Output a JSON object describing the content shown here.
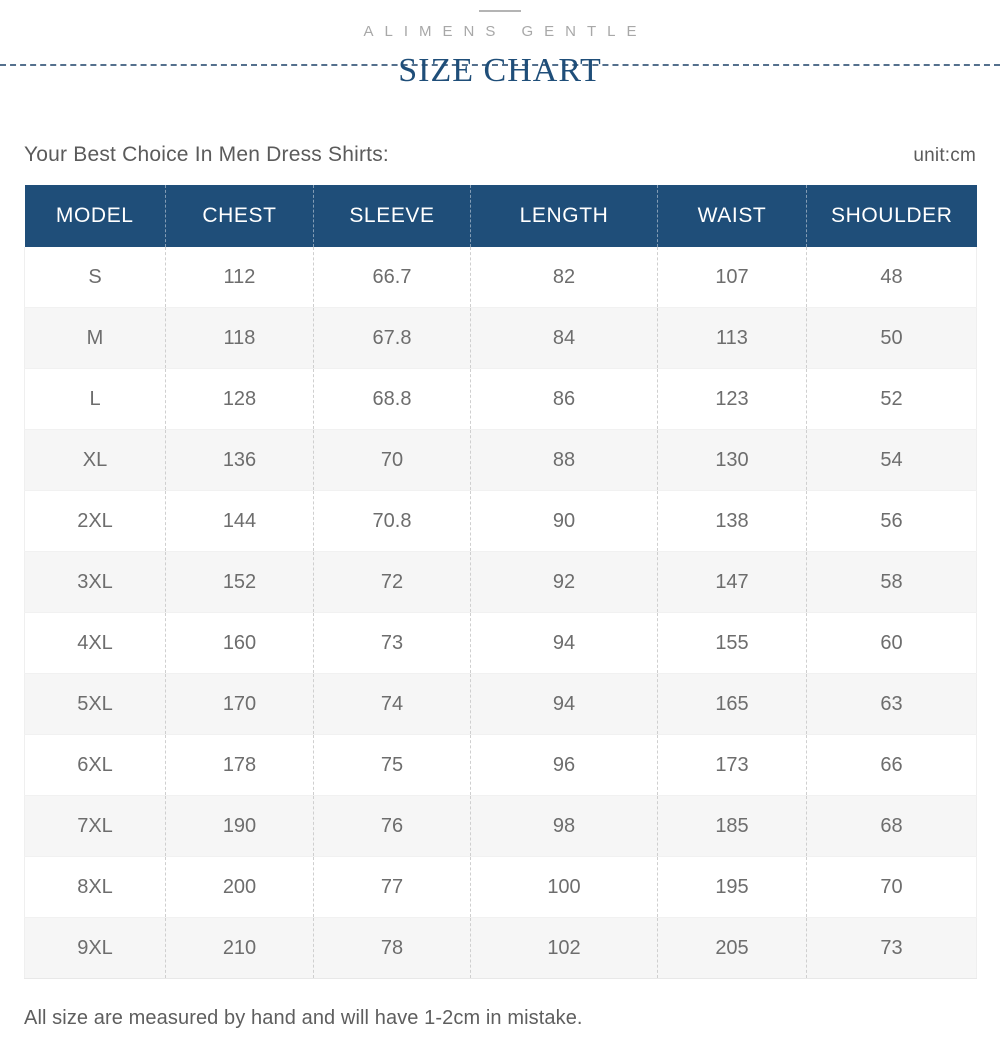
{
  "header": {
    "brand": "ALIMENS GENTLE",
    "title": "SIZE CHART",
    "accent_color": "#1f4e79",
    "brand_color": "#a8a8a8"
  },
  "subheader": {
    "intro": "Your Best Choice In Men Dress Shirts:",
    "unit": "unit:cm"
  },
  "table": {
    "columns": [
      "MODEL",
      "CHEST",
      "SLEEVE",
      "LENGTH",
      "WAIST",
      "SHOULDER"
    ],
    "header_bg": "#1f4e79",
    "rows": [
      {
        "model": "S",
        "chest": "112",
        "sleeve": "66.7",
        "length": "82",
        "waist": "107",
        "shoulder": "48"
      },
      {
        "model": "M",
        "chest": "118",
        "sleeve": "67.8",
        "length": "84",
        "waist": "113",
        "shoulder": "50"
      },
      {
        "model": "L",
        "chest": "128",
        "sleeve": "68.8",
        "length": "86",
        "waist": "123",
        "shoulder": "52"
      },
      {
        "model": "XL",
        "chest": "136",
        "sleeve": "70",
        "length": "88",
        "waist": "130",
        "shoulder": "54"
      },
      {
        "model": "2XL",
        "chest": "144",
        "sleeve": "70.8",
        "length": "90",
        "waist": "138",
        "shoulder": "56"
      },
      {
        "model": "3XL",
        "chest": "152",
        "sleeve": "72",
        "length": "92",
        "waist": "147",
        "shoulder": "58"
      },
      {
        "model": "4XL",
        "chest": "160",
        "sleeve": "73",
        "length": "94",
        "waist": "155",
        "shoulder": "60"
      },
      {
        "model": "5XL",
        "chest": "170",
        "sleeve": "74",
        "length": "94",
        "waist": "165",
        "shoulder": "63"
      },
      {
        "model": "6XL",
        "chest": "178",
        "sleeve": "75",
        "length": "96",
        "waist": "173",
        "shoulder": "66"
      },
      {
        "model": "7XL",
        "chest": "190",
        "sleeve": "76",
        "length": "98",
        "waist": "185",
        "shoulder": "68"
      },
      {
        "model": "8XL",
        "chest": "200",
        "sleeve": "77",
        "length": "100",
        "waist": "195",
        "shoulder": "70"
      },
      {
        "model": "9XL",
        "chest": "210",
        "sleeve": "78",
        "length": "102",
        "waist": "205",
        "shoulder": "73"
      }
    ]
  },
  "footer": {
    "note": "All size are measured by hand and will have 1-2cm in mistake."
  },
  "chart_data": {
    "type": "table",
    "title": "SIZE CHART",
    "subtitle": "Your Best Choice In Men Dress Shirts:",
    "unit": "cm",
    "columns": [
      "MODEL",
      "CHEST",
      "SLEEVE",
      "LENGTH",
      "WAIST",
      "SHOULDER"
    ],
    "categories": [
      "S",
      "M",
      "L",
      "XL",
      "2XL",
      "3XL",
      "4XL",
      "5XL",
      "6XL",
      "7XL",
      "8XL",
      "9XL"
    ],
    "series": [
      {
        "name": "CHEST",
        "values": [
          112,
          118,
          128,
          136,
          144,
          152,
          160,
          170,
          178,
          190,
          200,
          210
        ]
      },
      {
        "name": "SLEEVE",
        "values": [
          66.7,
          67.8,
          68.8,
          70,
          70.8,
          72,
          73,
          74,
          75,
          76,
          77,
          78
        ]
      },
      {
        "name": "LENGTH",
        "values": [
          82,
          84,
          86,
          88,
          90,
          92,
          94,
          94,
          96,
          98,
          100,
          102
        ]
      },
      {
        "name": "WAIST",
        "values": [
          107,
          113,
          123,
          130,
          138,
          147,
          155,
          165,
          173,
          185,
          195,
          205
        ]
      },
      {
        "name": "SHOULDER",
        "values": [
          48,
          50,
          52,
          54,
          56,
          58,
          60,
          63,
          66,
          68,
          70,
          73
        ]
      }
    ],
    "note": "All size are measured by hand and will have 1-2cm in mistake."
  }
}
